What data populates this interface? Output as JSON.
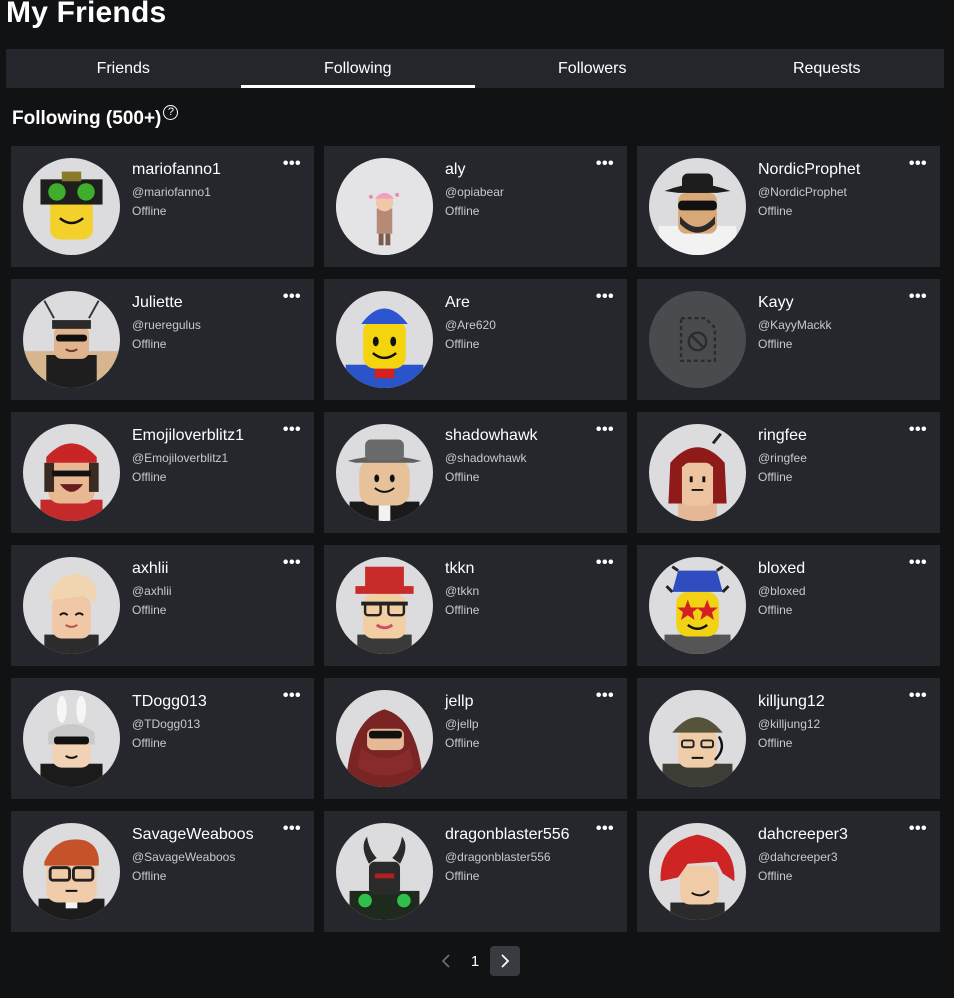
{
  "page": {
    "title": "My Friends"
  },
  "tabs": [
    {
      "label": "Friends"
    },
    {
      "label": "Following"
    },
    {
      "label": "Followers"
    },
    {
      "label": "Requests"
    }
  ],
  "section": {
    "title": "Following (500+)",
    "help_icon": "question-circle-icon"
  },
  "colors": {
    "background": "#111214",
    "card": "#25272c",
    "tabbar": "#24262b",
    "text": "#ffffff",
    "subtext": "#c8c9cc"
  },
  "users": [
    {
      "name": "mariofanno1",
      "handle": "@mariofanno1",
      "status": "Offline"
    },
    {
      "name": "aly",
      "handle": "@opiabear",
      "status": "Offline"
    },
    {
      "name": "NordicProphet",
      "handle": "@NordicProphet",
      "status": "Offline"
    },
    {
      "name": "Juliette",
      "handle": "@rueregulus",
      "status": "Offline"
    },
    {
      "name": "Are",
      "handle": "@Are620",
      "status": "Offline"
    },
    {
      "name": "Kayy",
      "handle": "@KayyMackk",
      "status": "Offline"
    },
    {
      "name": "Emojiloverblitz1",
      "handle": "@Emojiloverblitz1",
      "status": "Offline"
    },
    {
      "name": "shadowhawk",
      "handle": "@shadowhawk",
      "status": "Offline"
    },
    {
      "name": "ringfee",
      "handle": "@ringfee",
      "status": "Offline"
    },
    {
      "name": "axhlii",
      "handle": "@axhlii",
      "status": "Offline"
    },
    {
      "name": "tkkn",
      "handle": "@tkkn",
      "status": "Offline"
    },
    {
      "name": "bloxed",
      "handle": "@bloxed",
      "status": "Offline"
    },
    {
      "name": "TDogg013",
      "handle": "@TDogg013",
      "status": "Offline"
    },
    {
      "name": "jellp",
      "handle": "@jellp",
      "status": "Offline"
    },
    {
      "name": "killjung12",
      "handle": "@killjung12",
      "status": "Offline"
    },
    {
      "name": "SavageWeaboos",
      "handle": "@SavageWeaboos",
      "status": "Offline"
    },
    {
      "name": "dragonblaster556",
      "handle": "@dragonblaster556",
      "status": "Offline"
    },
    {
      "name": "dahcreeper3",
      "handle": "@dahcreeper3",
      "status": "Offline"
    }
  ],
  "pagination": {
    "current_page": "1",
    "prev_icon": "chevron-left-icon",
    "next_icon": "chevron-right-icon"
  }
}
